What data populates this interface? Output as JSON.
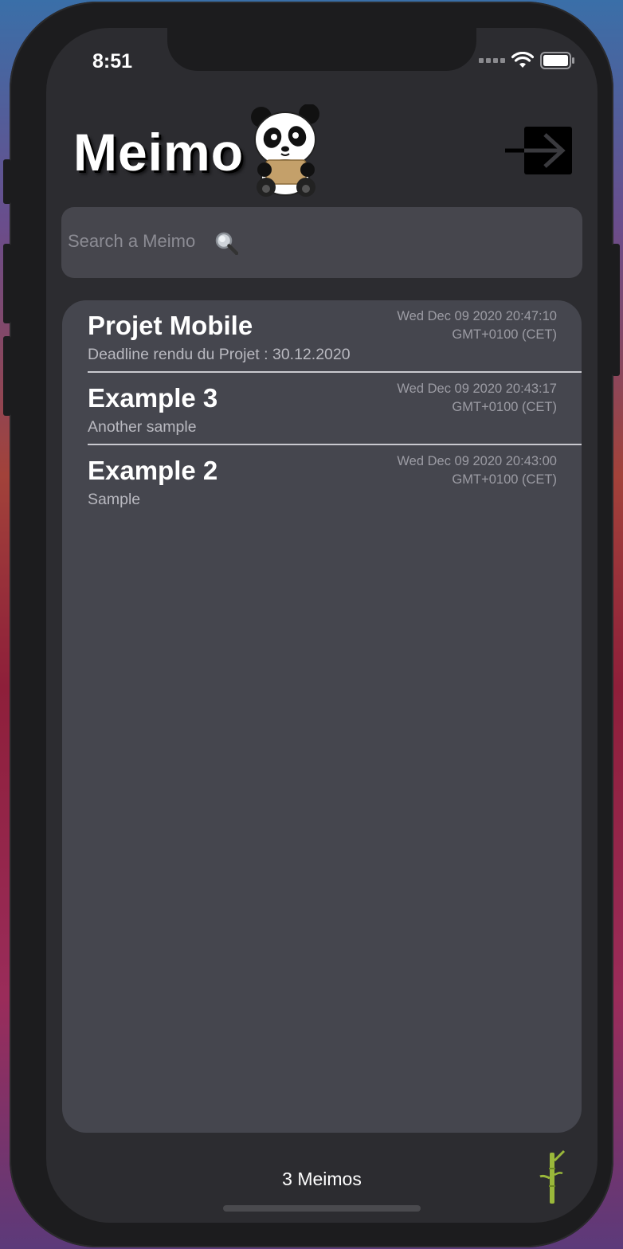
{
  "status_bar": {
    "time": "8:51",
    "icons": [
      "cellular-icon",
      "wifi-icon",
      "battery-icon"
    ]
  },
  "header": {
    "title": "Meimo",
    "mascot_icon": "panda-icon",
    "logout_icon": "logout-arrow-icon"
  },
  "search": {
    "placeholder": "Search a Meimo",
    "value": "",
    "icon": "magnifier-icon"
  },
  "memos": [
    {
      "title": "Projet Mobile",
      "body": "Deadline rendu du Projet : 30.12.2020",
      "date_line1": "Wed Dec 09 2020 20:47:10",
      "date_line2": "GMT+0100 (CET)"
    },
    {
      "title": "Example 3",
      "body": "Another sample",
      "date_line1": "Wed Dec 09 2020 20:43:17",
      "date_line2": "GMT+0100 (CET)"
    },
    {
      "title": "Example 2",
      "body": "Sample",
      "date_line1": "Wed Dec 09 2020 20:43:00",
      "date_line2": "GMT+0100 (CET)"
    }
  ],
  "footer": {
    "count_label": "3 Meimos",
    "add_icon": "bamboo-icon"
  },
  "colors": {
    "screen_bg": "#2c2c30",
    "card_bg": "#45464e",
    "search_bg": "#46464d",
    "bamboo_green": "#9ab83a"
  }
}
